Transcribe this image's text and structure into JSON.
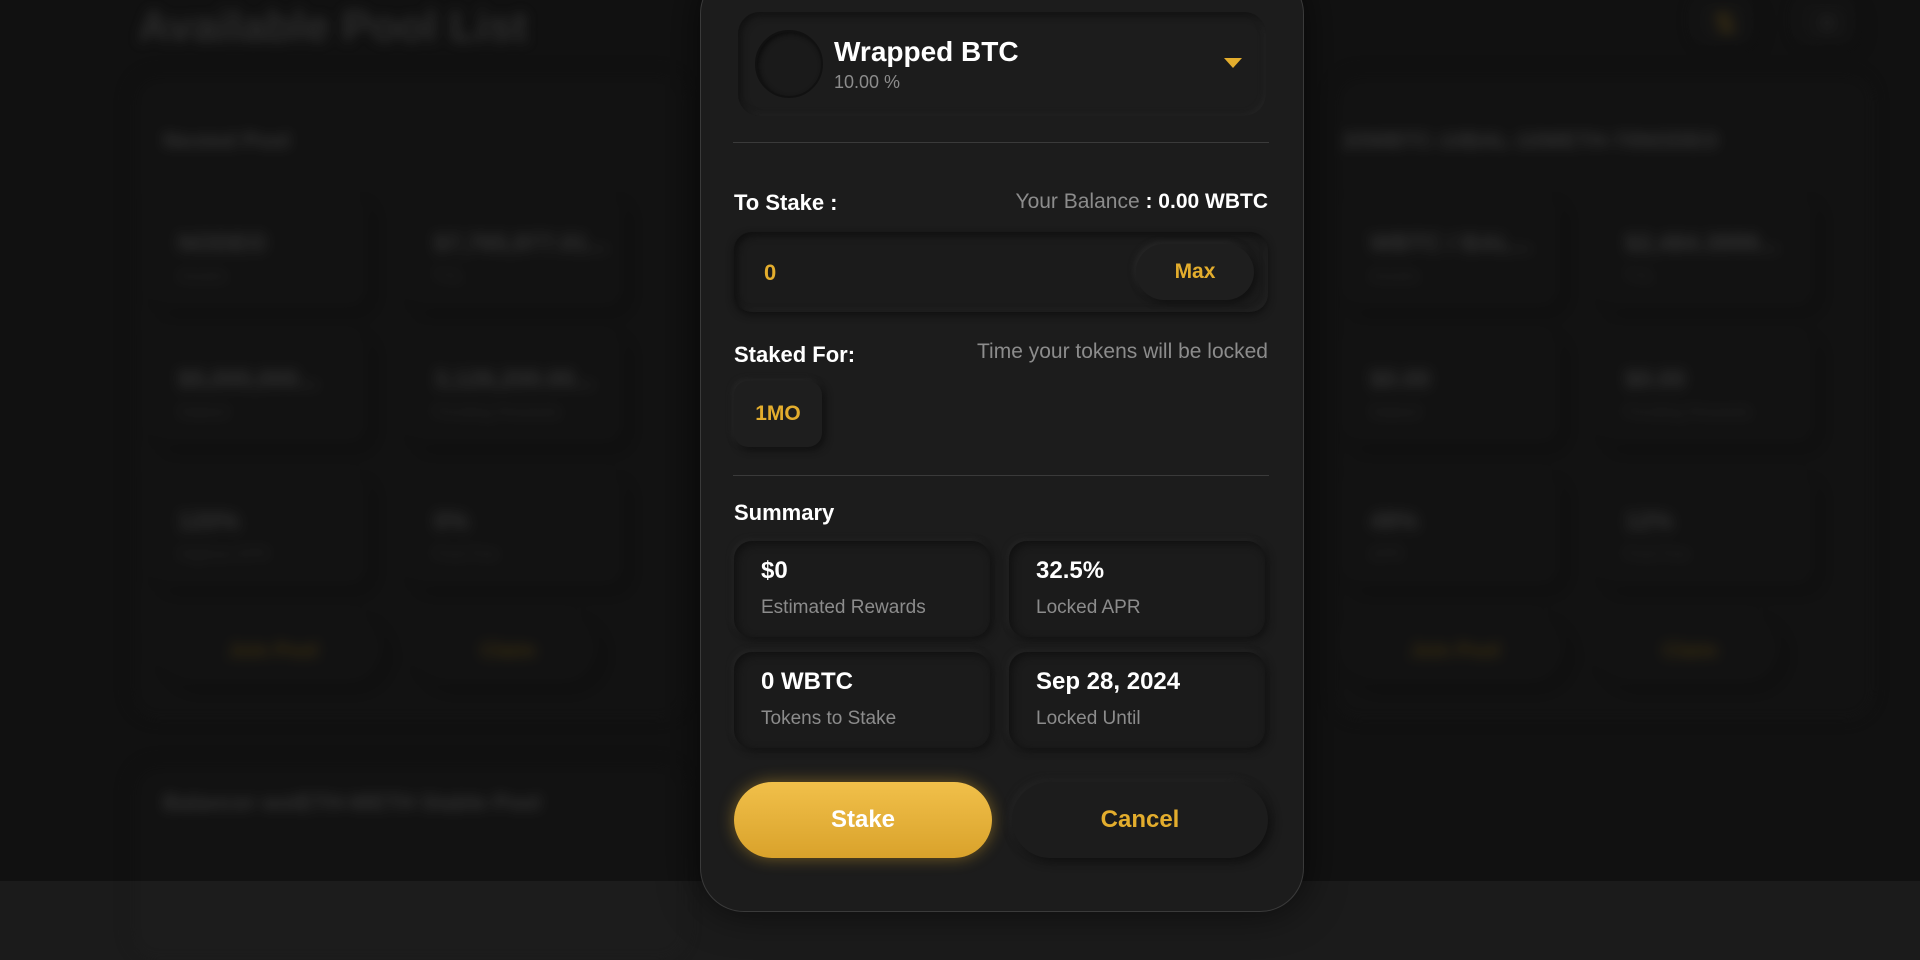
{
  "background": {
    "page_title": "Available Pool List",
    "pools": [
      {
        "name": "Nexted Pool",
        "stats": [
          {
            "value": "NODEO",
            "label": "Assets"
          },
          {
            "value": "$7,765,977.01...",
            "label": "TVL"
          },
          {
            "value": "$5,000,000...",
            "label": "Staked"
          },
          {
            "value": "3,126,200.00...",
            "label": "Pending Rewards"
          },
          {
            "value": "120%",
            "label": "Highest APR"
          },
          {
            "value": "0%",
            "label": "Pool Fee"
          }
        ],
        "buttons": [
          "Join Pool",
          "Claim"
        ]
      },
      {
        "name": "20WBTC-10BAL-10WETH-70NODEO",
        "stats": [
          {
            "value": "WBTC / BAL...",
            "label": "Assets"
          },
          {
            "value": "$2,484.3999...",
            "label": "TVL"
          },
          {
            "value": "$0.00",
            "label": "Staked"
          },
          {
            "value": "$0.00",
            "label": "Pending Rewards"
          },
          {
            "value": "49%",
            "label": "APR"
          },
          {
            "value": "12%",
            "label": "Pool Fee"
          }
        ],
        "buttons": [
          "Join Pool",
          "Claim"
        ]
      },
      {
        "name": "Balancer wstETH-WETH Stable Pool"
      }
    ]
  },
  "modal": {
    "token": {
      "name": "Wrapped BTC",
      "percentage": "10.00 %"
    },
    "to_stake_label": "To Stake :",
    "balance_label": "Your Balance",
    "balance_value": ": 0.00 WBTC",
    "amount_input_value": "0",
    "max_label": "Max",
    "staked_for_label": "Staked For:",
    "lock_hint": "Time your tokens will be locked",
    "period_label": "1MO",
    "summary_label": "Summary",
    "summary": [
      {
        "value": "$0",
        "label": "Estimated Rewards"
      },
      {
        "value": "32.5%",
        "label": "Locked APR"
      },
      {
        "value": "0 WBTC",
        "label": "Tokens to Stake"
      },
      {
        "value": "Sep 28, 2024",
        "label": "Locked Until"
      }
    ],
    "stake_label": "Stake",
    "cancel_label": "Cancel"
  },
  "colors": {
    "accent": "#e3ad2d",
    "background": "#1b1b1b",
    "muted_text": "#8c8c8c"
  }
}
